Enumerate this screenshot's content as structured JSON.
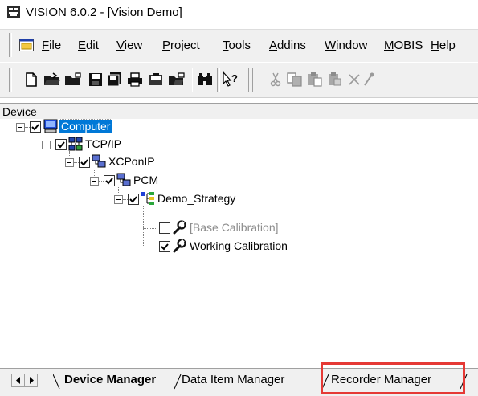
{
  "window": {
    "title": "VISION 6.0.2  - [Vision Demo]"
  },
  "menu": {
    "items": [
      {
        "label": "File",
        "accel": "F",
        "rest": "ile"
      },
      {
        "label": "Edit",
        "accel": "E",
        "rest": "dit"
      },
      {
        "label": "View",
        "accel": "V",
        "rest": "iew"
      },
      {
        "label": "Project",
        "accel": "P",
        "rest": "roject"
      },
      {
        "label": "Tools",
        "accel": "T",
        "rest": "ools"
      },
      {
        "label": "Addins",
        "accel": "A",
        "rest": "ddins"
      },
      {
        "label": "Window",
        "accel": "W",
        "rest": "indow"
      },
      {
        "label": "MOBIS",
        "accel": "M",
        "rest": "OBIS"
      },
      {
        "label": "Help",
        "accel": "H",
        "rest": "elp"
      }
    ]
  },
  "toolbar": {
    "buttons": [
      "new-icon",
      "open-icon",
      "open-folder-icon",
      "save-icon",
      "save-all-icon",
      "print-icon",
      "project-icon",
      "browse-icon",
      "find-icon",
      "context-help-icon",
      "cut-icon",
      "copy-icon",
      "paste-icon",
      "paste-special-icon",
      "delete-icon"
    ]
  },
  "device_panel": {
    "title": "Device",
    "tree": [
      {
        "label": "Computer",
        "checked": true,
        "selected": true
      },
      {
        "label": "TCP/IP",
        "checked": true
      },
      {
        "label": "XCPonIP",
        "checked": true
      },
      {
        "label": "PCM",
        "checked": true
      },
      {
        "label": "Demo_Strategy",
        "checked": true
      },
      {
        "label": "[Base Calibration]",
        "checked": false,
        "disabled": true
      },
      {
        "label": "Working Calibration",
        "checked": true
      }
    ]
  },
  "tabs": [
    {
      "label": "Device Manager",
      "active": true
    },
    {
      "label": "Data Item Manager",
      "active": false
    },
    {
      "label": "Recorder Manager",
      "active": false,
      "highlighted": true
    }
  ],
  "colors": {
    "selection": "#0078d7",
    "highlight": "#e53935",
    "chrome": "#f0f0f0"
  }
}
